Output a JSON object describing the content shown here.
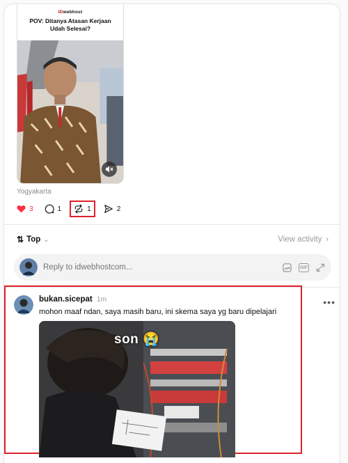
{
  "post": {
    "video": {
      "brand_prefix": "ID",
      "brand_name": "webhost",
      "caption": "POV: Ditanya Atasan Kerjaan Udah Selesai?",
      "mute_icon": "speaker-muted-icon"
    },
    "location": "Yogyakarta",
    "actions": {
      "likes": "3",
      "comments": "1",
      "reposts": "1",
      "shares": "2",
      "liked": true,
      "like_color": "#ff3040"
    }
  },
  "sort": {
    "label": "Top",
    "icon": "sort-arrows-icon",
    "activity_label": "View activity"
  },
  "reply_box": {
    "placeholder": "Reply to idwebhostcom..."
  },
  "comment": {
    "username": "bukan.sicepat",
    "time": "1m",
    "text": "mohon maaf ndan, saya masih baru, ini skema saya yg baru dipelajari",
    "media_caption": "son 😭"
  },
  "highlight_color": "#e0202a"
}
